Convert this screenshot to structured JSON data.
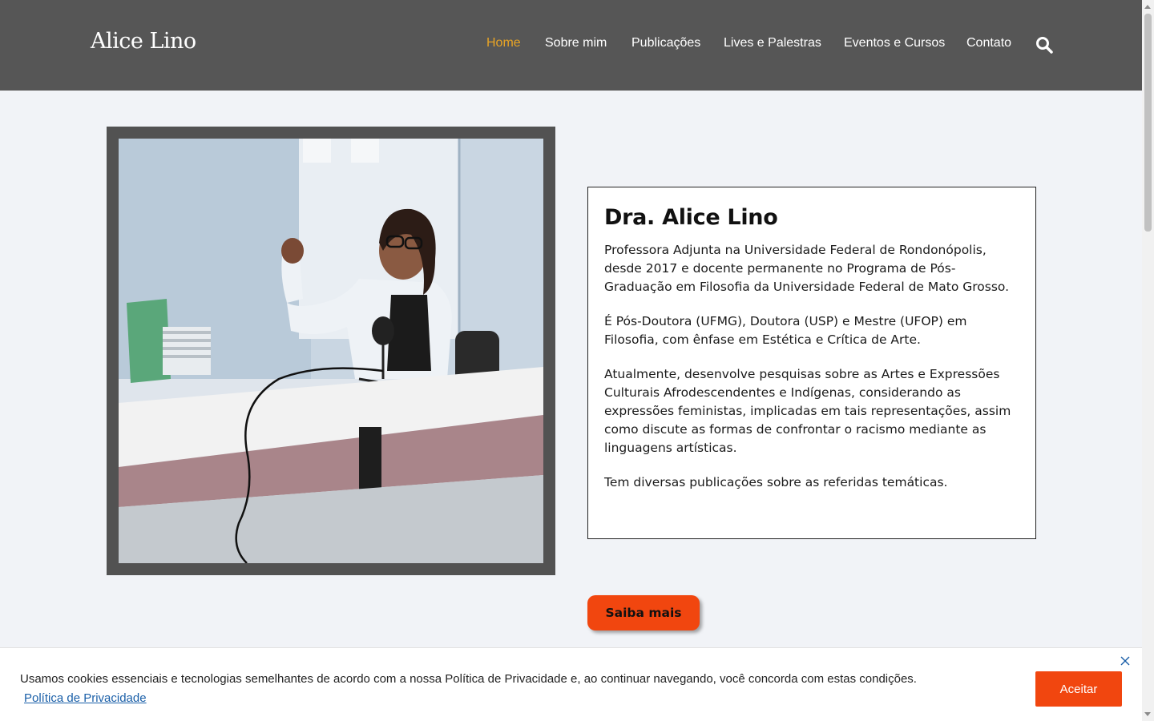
{
  "site": {
    "logo": "Alice Lino"
  },
  "nav": {
    "items": [
      {
        "label": "Home",
        "active": true
      },
      {
        "label": "Sobre mim",
        "active": false
      },
      {
        "label": "Publicações",
        "active": false
      },
      {
        "label": "Lives e Palestras",
        "active": false
      },
      {
        "label": "Eventos e Cursos",
        "active": false
      },
      {
        "label": "Contato",
        "active": false
      }
    ],
    "search_icon": "search-icon"
  },
  "hero": {
    "photo_icon": "portrait-photo",
    "title": "Dra. Alice Lino",
    "paragraphs": [
      "Professora Adjunta na Universidade Federal de Rondonópolis, desde 2017 e docente permanente no Programa de Pós-Graduação em Filosofia da Universidade Federal de Mato Grosso.",
      "É Pós-Doutora (UFMG), Doutora (USP) e Mestre (UFOP) em Filosofia, com ênfase em Estética e Crítica de Arte.",
      "Atualmente, desenvolve pesquisas sobre as Artes e Expressões Culturais Afrodescendentes e Indígenas, considerando as expressões feministas, implicadas em tais representações, assim como discute as formas de confrontar o racismo mediante as linguagens artísticas.",
      "Tem diversas publicações sobre as referidas temáticas."
    ],
    "more_button": "Saiba mais"
  },
  "cookie": {
    "text": "Usamos cookies essenciais e tecnologias semelhantes de acordo com a nossa Política de Privacidade e, ao continuar navegando, você concorda com estas condições.",
    "link": "Política de Privacidade",
    "accept": "Aceitar",
    "close_icon": "close-icon"
  },
  "colors": {
    "header_bg": "#565656",
    "nav_active": "#e8a425",
    "accent": "#f1460f",
    "page_bg": "#f1f3f7",
    "link": "#1a5fa8"
  }
}
